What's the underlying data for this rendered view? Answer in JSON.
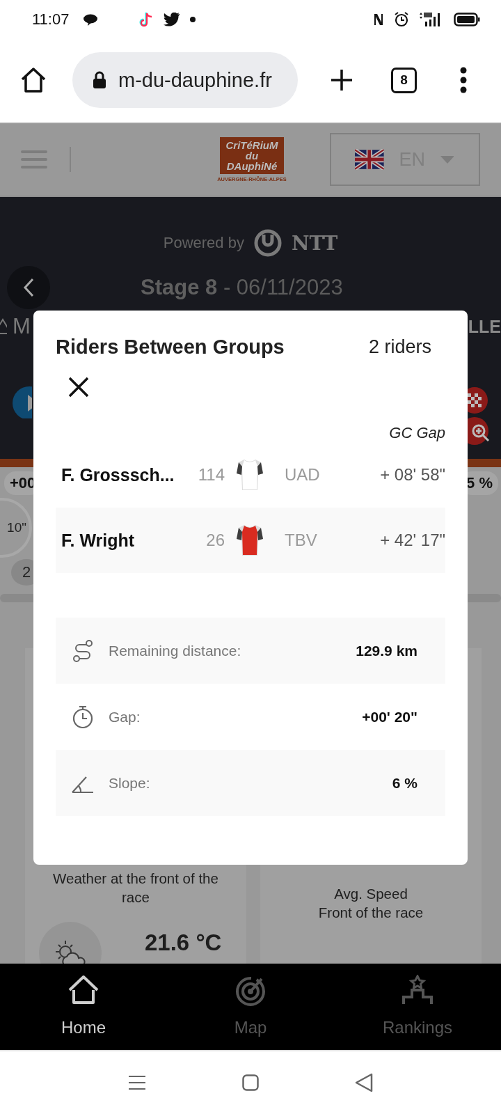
{
  "status_bar": {
    "time": "11:07"
  },
  "browser": {
    "url": "m-du-dauphine.fr",
    "tab_count": "8"
  },
  "site_header": {
    "logo_lines": [
      "CriTéRiuM",
      "du",
      "DAuphiNé"
    ],
    "logo_region": "AUVERGNE-RHÔNE-ALPES",
    "language": "EN"
  },
  "stage_panel": {
    "powered_by": "Powered by",
    "sponsor": "NTT",
    "stage": "**Stage 8** - 06/11/2023",
    "left_fragment": "M",
    "right_fragment": "LLE"
  },
  "live_fragments": {
    "gap_chip": "+00",
    "circle_time": "10\"",
    "group_chip": "2",
    "slope_chip": "5 %"
  },
  "modal": {
    "title": "Riders Between Groups",
    "count": "2 riders",
    "column_header": "GC Gap",
    "riders": [
      {
        "name": "F. Grosssch...",
        "number": "114",
        "team": "UAD",
        "gap": "+ 08' 58\"",
        "color": "#ffffff"
      },
      {
        "name": "F. Wright",
        "number": "26",
        "team": "TBV",
        "gap": "+ 42' 17\"",
        "color": "#d92b20"
      }
    ],
    "stats": [
      {
        "kind": "distance",
        "label": "Remaining distance:",
        "value": "129.9 km"
      },
      {
        "kind": "gap",
        "label": "Gap:",
        "value": "+00' 20\""
      },
      {
        "kind": "slope",
        "label": "Slope:",
        "value": "6 %"
      }
    ]
  },
  "cards": {
    "weather_title": "Weather at the front of the race",
    "temperature": "21.6 °C",
    "speed_title_lines": [
      "Avg. Speed",
      "Front of the race"
    ]
  },
  "bottom_nav": [
    {
      "kind": "home",
      "label": "Home",
      "selected": true
    },
    {
      "kind": "map",
      "label": "Map",
      "selected": false
    },
    {
      "kind": "rankings",
      "label": "Rankings",
      "selected": false
    }
  ]
}
